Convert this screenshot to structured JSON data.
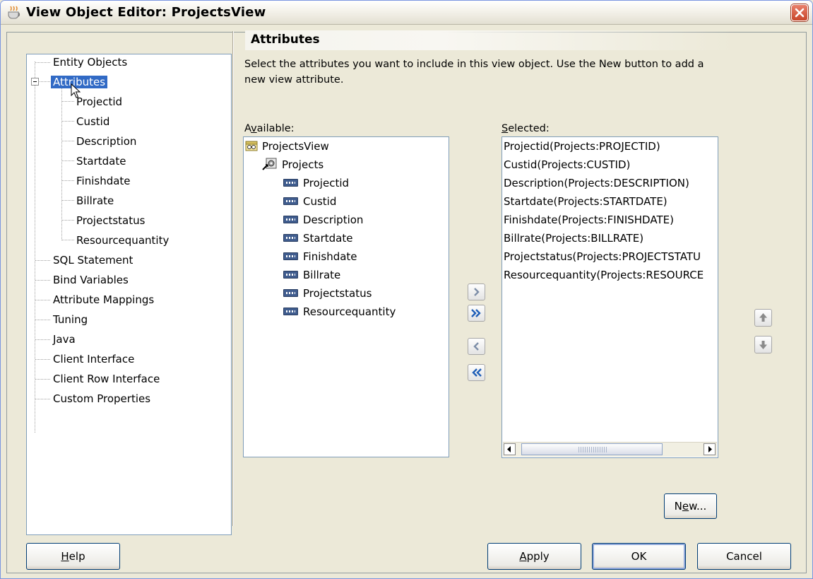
{
  "window": {
    "title": "View Object Editor: ProjectsView",
    "close_label": "close-icon"
  },
  "nav": {
    "items": [
      {
        "label": "Entity Objects",
        "level": 0
      },
      {
        "label": "Attributes",
        "level": 0,
        "expanded": true,
        "selected": true
      },
      {
        "label": "Projectid",
        "level": 1
      },
      {
        "label": "Custid",
        "level": 1
      },
      {
        "label": "Description",
        "level": 1
      },
      {
        "label": "Startdate",
        "level": 1
      },
      {
        "label": "Finishdate",
        "level": 1
      },
      {
        "label": "Billrate",
        "level": 1
      },
      {
        "label": "Projectstatus",
        "level": 1
      },
      {
        "label": "Resourcequantity",
        "level": 1
      },
      {
        "label": "SQL Statement",
        "level": 0
      },
      {
        "label": "Bind Variables",
        "level": 0
      },
      {
        "label": "Attribute Mappings",
        "level": 0
      },
      {
        "label": "Tuning",
        "level": 0
      },
      {
        "label": "Java",
        "level": 0
      },
      {
        "label": "Client Interface",
        "level": 0
      },
      {
        "label": "Client Row Interface",
        "level": 0
      },
      {
        "label": "Custom Properties",
        "level": 0
      }
    ]
  },
  "panel": {
    "title": "Attributes",
    "description_line1": "Select the attributes you want to include in this view object.  Use the New button to add a",
    "description_line2": "new view attribute.",
    "available_label": "Available:",
    "selected_label": "Selected:",
    "available": {
      "root": "ProjectsView",
      "entity": "Projects",
      "attributes": [
        "Projectid",
        "Custid",
        "Description",
        "Startdate",
        "Finishdate",
        "Billrate",
        "Projectstatus",
        "Resourcequantity"
      ]
    },
    "selected": [
      "Projectid(Projects:PROJECTID)",
      "Custid(Projects:CUSTID)",
      "Description(Projects:DESCRIPTION)",
      "Startdate(Projects:STARTDATE)",
      "Finishdate(Projects:FINISHDATE)",
      "Billrate(Projects:BILLRATE)",
      "Projectstatus(Projects:PROJECTSTATU",
      "Resourcequantity(Projects:RESOURCE"
    ],
    "new_button": "New..."
  },
  "buttons": {
    "help": "Help",
    "apply": "Apply",
    "ok": "OK",
    "cancel": "Cancel"
  },
  "colors": {
    "selection": "#316ac5",
    "dialog_bg": "#ece9d8",
    "shuttle_arrow": "#1f5fb8"
  }
}
